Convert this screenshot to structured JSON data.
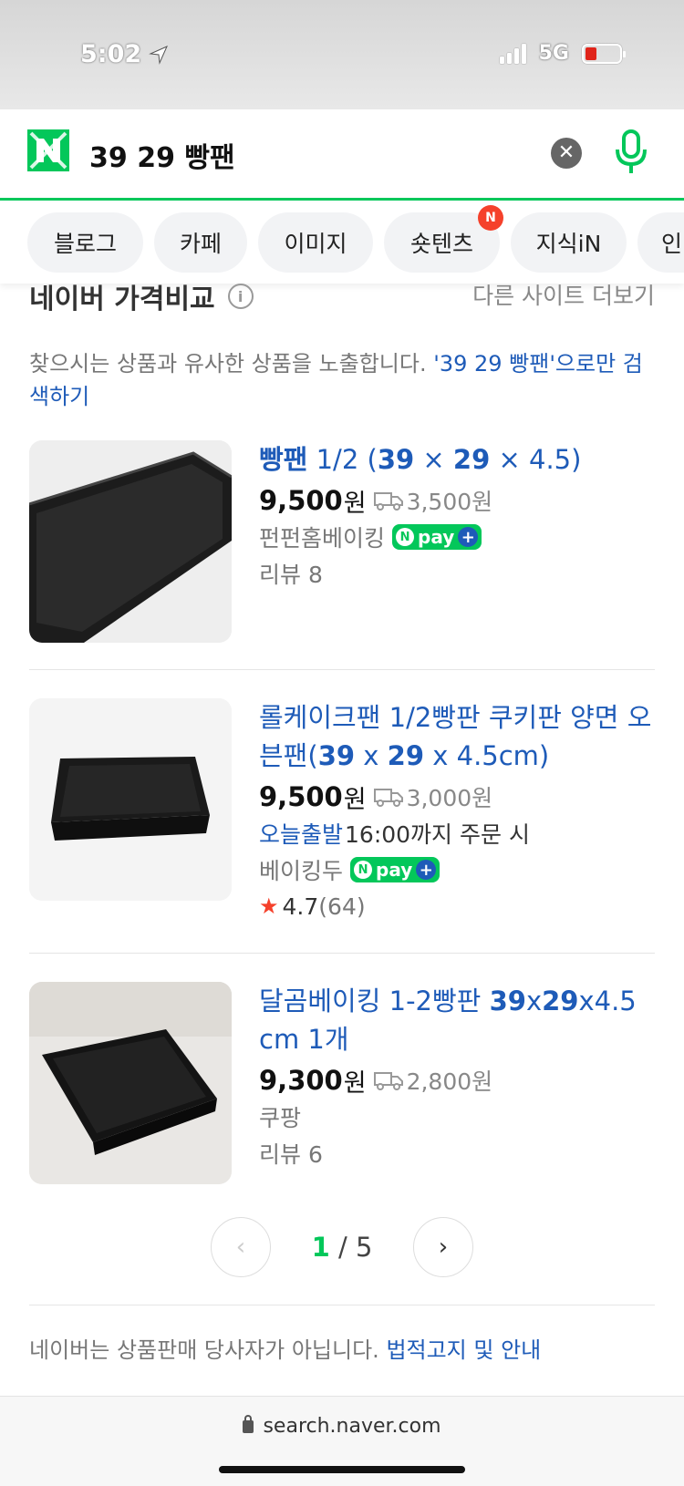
{
  "status_bar": {
    "time": "5:02",
    "network": "5G"
  },
  "search": {
    "query": "39 29 빵팬"
  },
  "tabs": [
    {
      "label": "블로그"
    },
    {
      "label": "카페"
    },
    {
      "label": "이미지"
    },
    {
      "label": "숏텐츠",
      "badge": "N"
    },
    {
      "label": "지식iN"
    },
    {
      "label": "인"
    }
  ],
  "section": {
    "title": "네이버 가격비교",
    "more": "다른 사이트 더보기",
    "notice_text": "찾으시는 상품과 유사한 상품을 노출합니다.",
    "notice_link": "'39 29 빵팬'으로만 검색하기"
  },
  "products": [
    {
      "title_parts": [
        "빵팬",
        " 1/2 (",
        "39",
        " × ",
        "29",
        " × 4.5)"
      ],
      "price": "9,500",
      "won": "원",
      "shipping": "3,500원",
      "seller": "펀펀홈베이킹",
      "npay": "pay",
      "review": "리뷰 8"
    },
    {
      "title_parts": [
        "롤케이크팬 1/2빵판 쿠키판 양면 오븐팬(",
        "39",
        " x ",
        "29",
        " x 4.5cm)"
      ],
      "price": "9,500",
      "won": "원",
      "shipping": "3,000원",
      "fast_label": "오늘출발",
      "fast_text": "16:00까지 주문 시",
      "seller": "베이킹두",
      "npay": "pay",
      "rating": "4.7",
      "rating_count": "(64)"
    },
    {
      "title_parts": [
        "달곰베이킹 1-2빵판 ",
        "39",
        "x",
        "29",
        "x4.5 cm 1개"
      ],
      "price": "9,300",
      "won": "원",
      "shipping": "2,800원",
      "seller": "쿠팡",
      "review": "리뷰 6"
    }
  ],
  "pager": {
    "current": "1",
    "separator": " / ",
    "total": "5"
  },
  "disclaimer": {
    "text": "네이버는 상품판매 당사자가 아닙니다. ",
    "link": "법적고지 및 안내"
  },
  "url_bar": {
    "url": "search.naver.com"
  },
  "colors": {
    "brand_green": "#03c75a",
    "link_blue": "#1e5bb8",
    "badge_red": "#f5412b"
  }
}
